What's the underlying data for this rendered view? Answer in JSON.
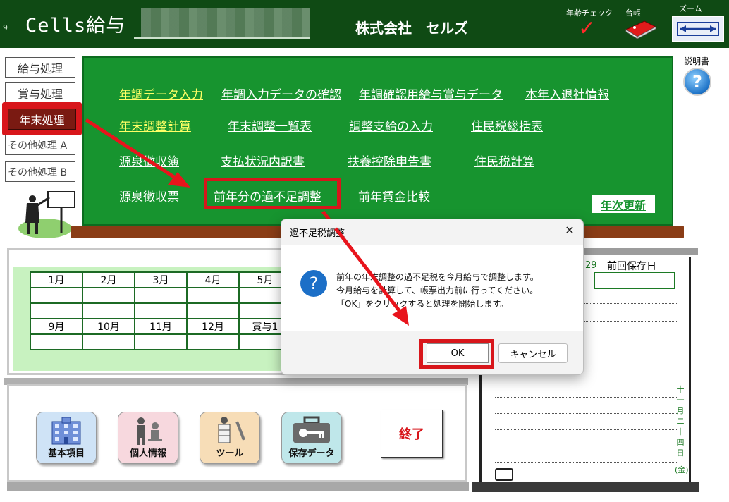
{
  "header": {
    "title": "Cells給与",
    "small_num": "9",
    "company": "株式会社　セルズ",
    "age_check_label": "年齢チェック",
    "ledger_label": "台帳",
    "zoom_label": "ズーム"
  },
  "side_menu": {
    "items": [
      {
        "label": "給与処理"
      },
      {
        "label": "賞与処理"
      },
      {
        "label": "年末処理"
      },
      {
        "label": "その他処理 A"
      },
      {
        "label": "その他処理 B"
      }
    ]
  },
  "board": {
    "row1": [
      "年調データ入力",
      "年調入力データの確認",
      "年調確認用給与賞与データ",
      "本年入退社情報"
    ],
    "row2": [
      "年末調整計算",
      "年末調整一覧表",
      "調整支給の入力",
      "住民税総括表"
    ],
    "row3": [
      "源泉徴収簿",
      "支払状況内訳書",
      "扶養控除申告書",
      "住民税計算"
    ],
    "row4": [
      "源泉徴収票",
      "前年分の過不足調整",
      "前年賃金比較"
    ],
    "annual_update": "年次更新"
  },
  "manual_label": "説明書",
  "help_icon": "question-help-icon",
  "months": {
    "row1": [
      "1月",
      "2月",
      "3月",
      "4月",
      "5月"
    ],
    "row2": [
      "9月",
      "10月",
      "11月",
      "12月",
      "賞与1"
    ]
  },
  "right_panel": {
    "date_fragment": "29",
    "save_label": "前回保存日",
    "vertical_date": [
      "十",
      "一",
      "月",
      "二",
      "十",
      "四",
      "日"
    ],
    "weekday": "(金)"
  },
  "bottom": {
    "tiles": [
      {
        "label": "基本項目",
        "icon": "building-icon",
        "color": "#cfe3f6"
      },
      {
        "label": "個人情報",
        "icon": "people-icon",
        "color": "#f7d8de"
      },
      {
        "label": "ツール",
        "icon": "tools-icon",
        "color": "#f7ddb7"
      },
      {
        "label": "保存データ",
        "icon": "toolbox-key-icon",
        "color": "#bfe7ea"
      }
    ],
    "exit_label": "終了"
  },
  "dialog": {
    "title": "過不足税調整",
    "close": "✕",
    "icon": "?",
    "lines": [
      "前年の年末調整の過不足税を今月給与で調整します。",
      "今月給与を計算して、帳票出力前に行ってください。",
      "「OK」をクリックすると処理を開始します。"
    ],
    "ok": "OK",
    "cancel": "キャンセル"
  },
  "colors": {
    "header_bg": "#0f4a14",
    "board_bg": "#17942f",
    "highlight_red": "#d8161b",
    "dialog_blue": "#1c6fc7"
  }
}
